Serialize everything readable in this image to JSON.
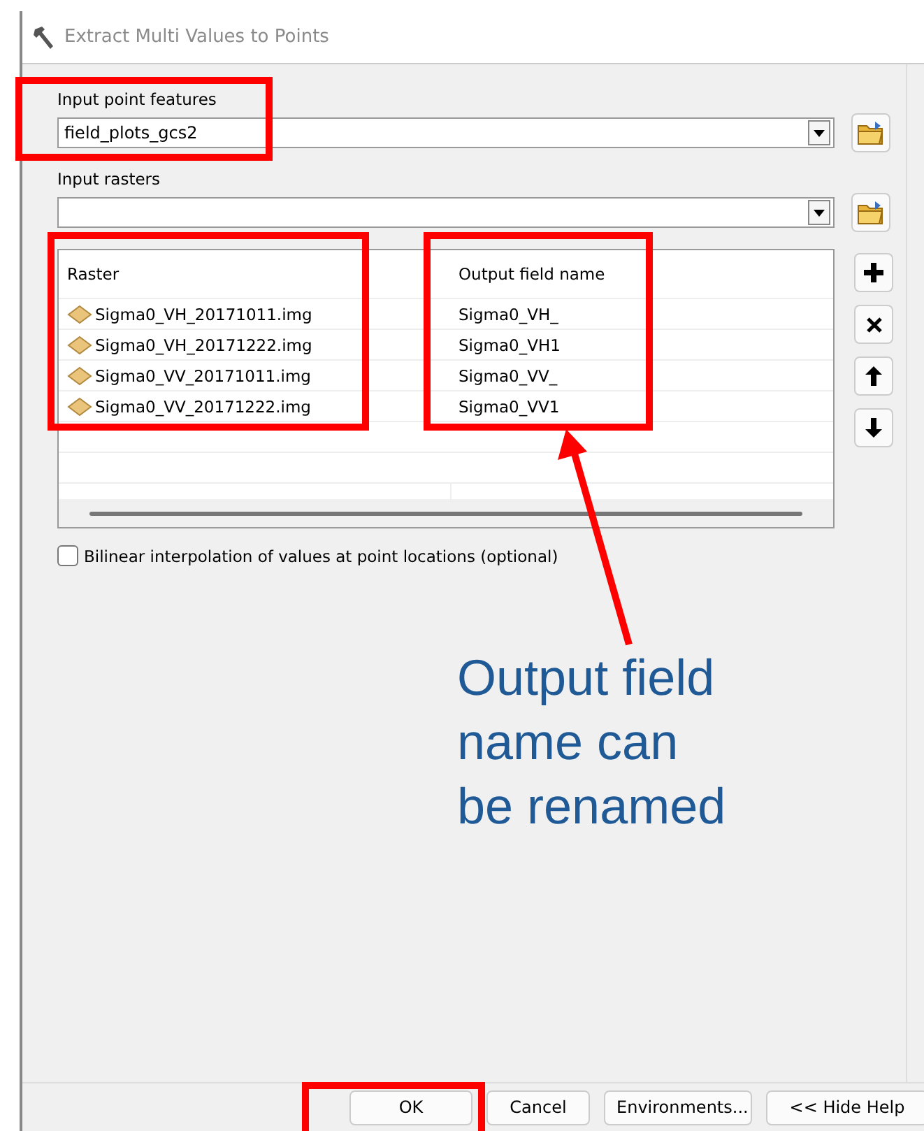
{
  "window": {
    "title": "Extract Multi Values to Points"
  },
  "input_point_features": {
    "label": "Input point features",
    "value": "field_plots_gcs2"
  },
  "input_rasters": {
    "label": "Input rasters"
  },
  "table": {
    "columns": [
      "Raster",
      "Output field name"
    ],
    "rows": [
      {
        "raster": "Sigma0_VH_20171011.img",
        "output_field_name": "Sigma0_VH_"
      },
      {
        "raster": "Sigma0_VH_20171222.img",
        "output_field_name": "Sigma0_VH1"
      },
      {
        "raster": "Sigma0_VV_20171011.img",
        "output_field_name": "Sigma0_VV_"
      },
      {
        "raster": "Sigma0_VV_20171222.img",
        "output_field_name": "Sigma0_VV1"
      }
    ]
  },
  "bilinear": {
    "label": "Bilinear interpolation of values at point locations (optional)",
    "checked": false
  },
  "buttons": [
    "OK",
    "Cancel",
    "Environments...",
    "<< Hide Help"
  ],
  "annotation": {
    "note": "Output field\nname can\nbe renamed"
  }
}
